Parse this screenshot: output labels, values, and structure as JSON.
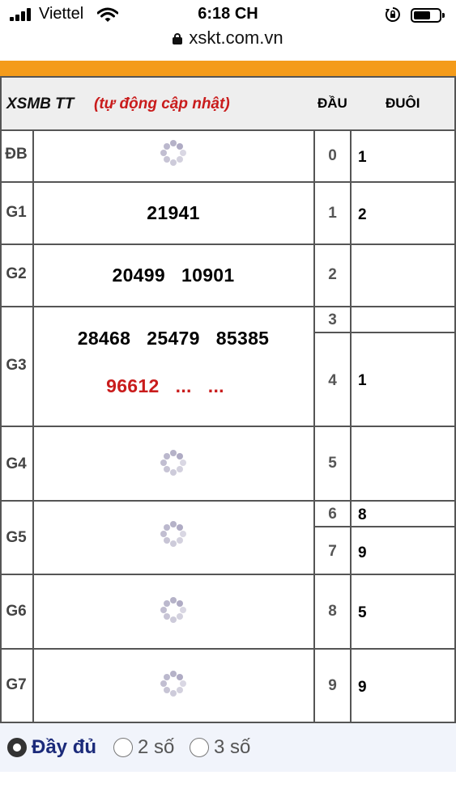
{
  "status_bar": {
    "carrier": "Viettel",
    "time": "6:18 CH"
  },
  "browser": {
    "url": "xskt.com.vn"
  },
  "table": {
    "title": "XSMB TT",
    "subtitle": "(tự động cập nhật)",
    "col_dau": "ĐẦU",
    "col_duoi": "ĐUÔI",
    "prizes": [
      {
        "label": "ĐB",
        "numbers": "",
        "loading": true
      },
      {
        "label": "G1",
        "numbers": "21941",
        "loading": false
      },
      {
        "label": "G2",
        "numbers": "20499   10901",
        "loading": false
      },
      {
        "label": "G3",
        "numbers": "28468   25479   85385",
        "numbers_2": "96612   ...   ...",
        "loading": false
      },
      {
        "label": "G4",
        "numbers": "",
        "loading": true
      },
      {
        "label": "G5",
        "numbers": "",
        "loading": true
      },
      {
        "label": "G6",
        "numbers": "",
        "loading": true
      },
      {
        "label": "G7",
        "numbers": "",
        "loading": true
      }
    ],
    "heads_tails": [
      {
        "dau": "0",
        "duoi": "1"
      },
      {
        "dau": "1",
        "duoi": "2"
      },
      {
        "dau": "2",
        "duoi": ""
      },
      {
        "dau": "3",
        "duoi": ""
      },
      {
        "dau": "4",
        "duoi": "1"
      },
      {
        "dau": "5",
        "duoi": ""
      },
      {
        "dau": "6",
        "duoi": "8"
      },
      {
        "dau": "7",
        "duoi": "9"
      },
      {
        "dau": "8",
        "duoi": "5"
      },
      {
        "dau": "9",
        "duoi": "9"
      }
    ]
  },
  "display_options": [
    {
      "label": "Đầy đủ",
      "selected": true
    },
    {
      "label": "2 số",
      "selected": false
    },
    {
      "label": "3 số",
      "selected": false
    }
  ],
  "colors": {
    "accent_orange": "#f49b1a",
    "live_red": "#c91c1c",
    "selected_blue": "#1b2a7a"
  }
}
